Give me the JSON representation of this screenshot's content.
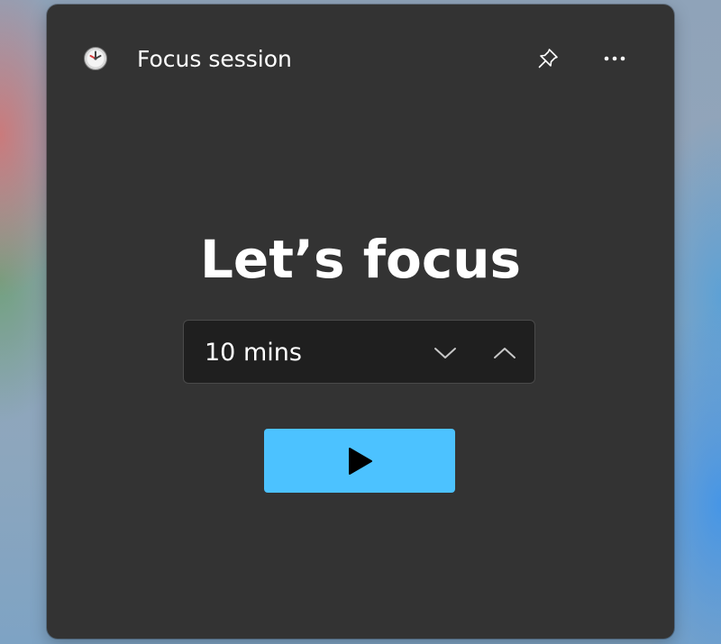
{
  "widget": {
    "title": "Focus session",
    "icon": "clock-icon",
    "pin_icon": "pin-icon",
    "more_icon": "more-options-icon"
  },
  "main": {
    "headline": "Let’s focus",
    "duration": {
      "value": "10 mins",
      "decrease_icon": "chevron-down-icon",
      "increase_icon": "chevron-up-icon"
    },
    "start": {
      "icon": "play-icon"
    }
  },
  "colors": {
    "widget_background": "#333333",
    "duration_background": "#1f1f1f",
    "accent": "#4cc2ff",
    "text": "#ffffff"
  }
}
